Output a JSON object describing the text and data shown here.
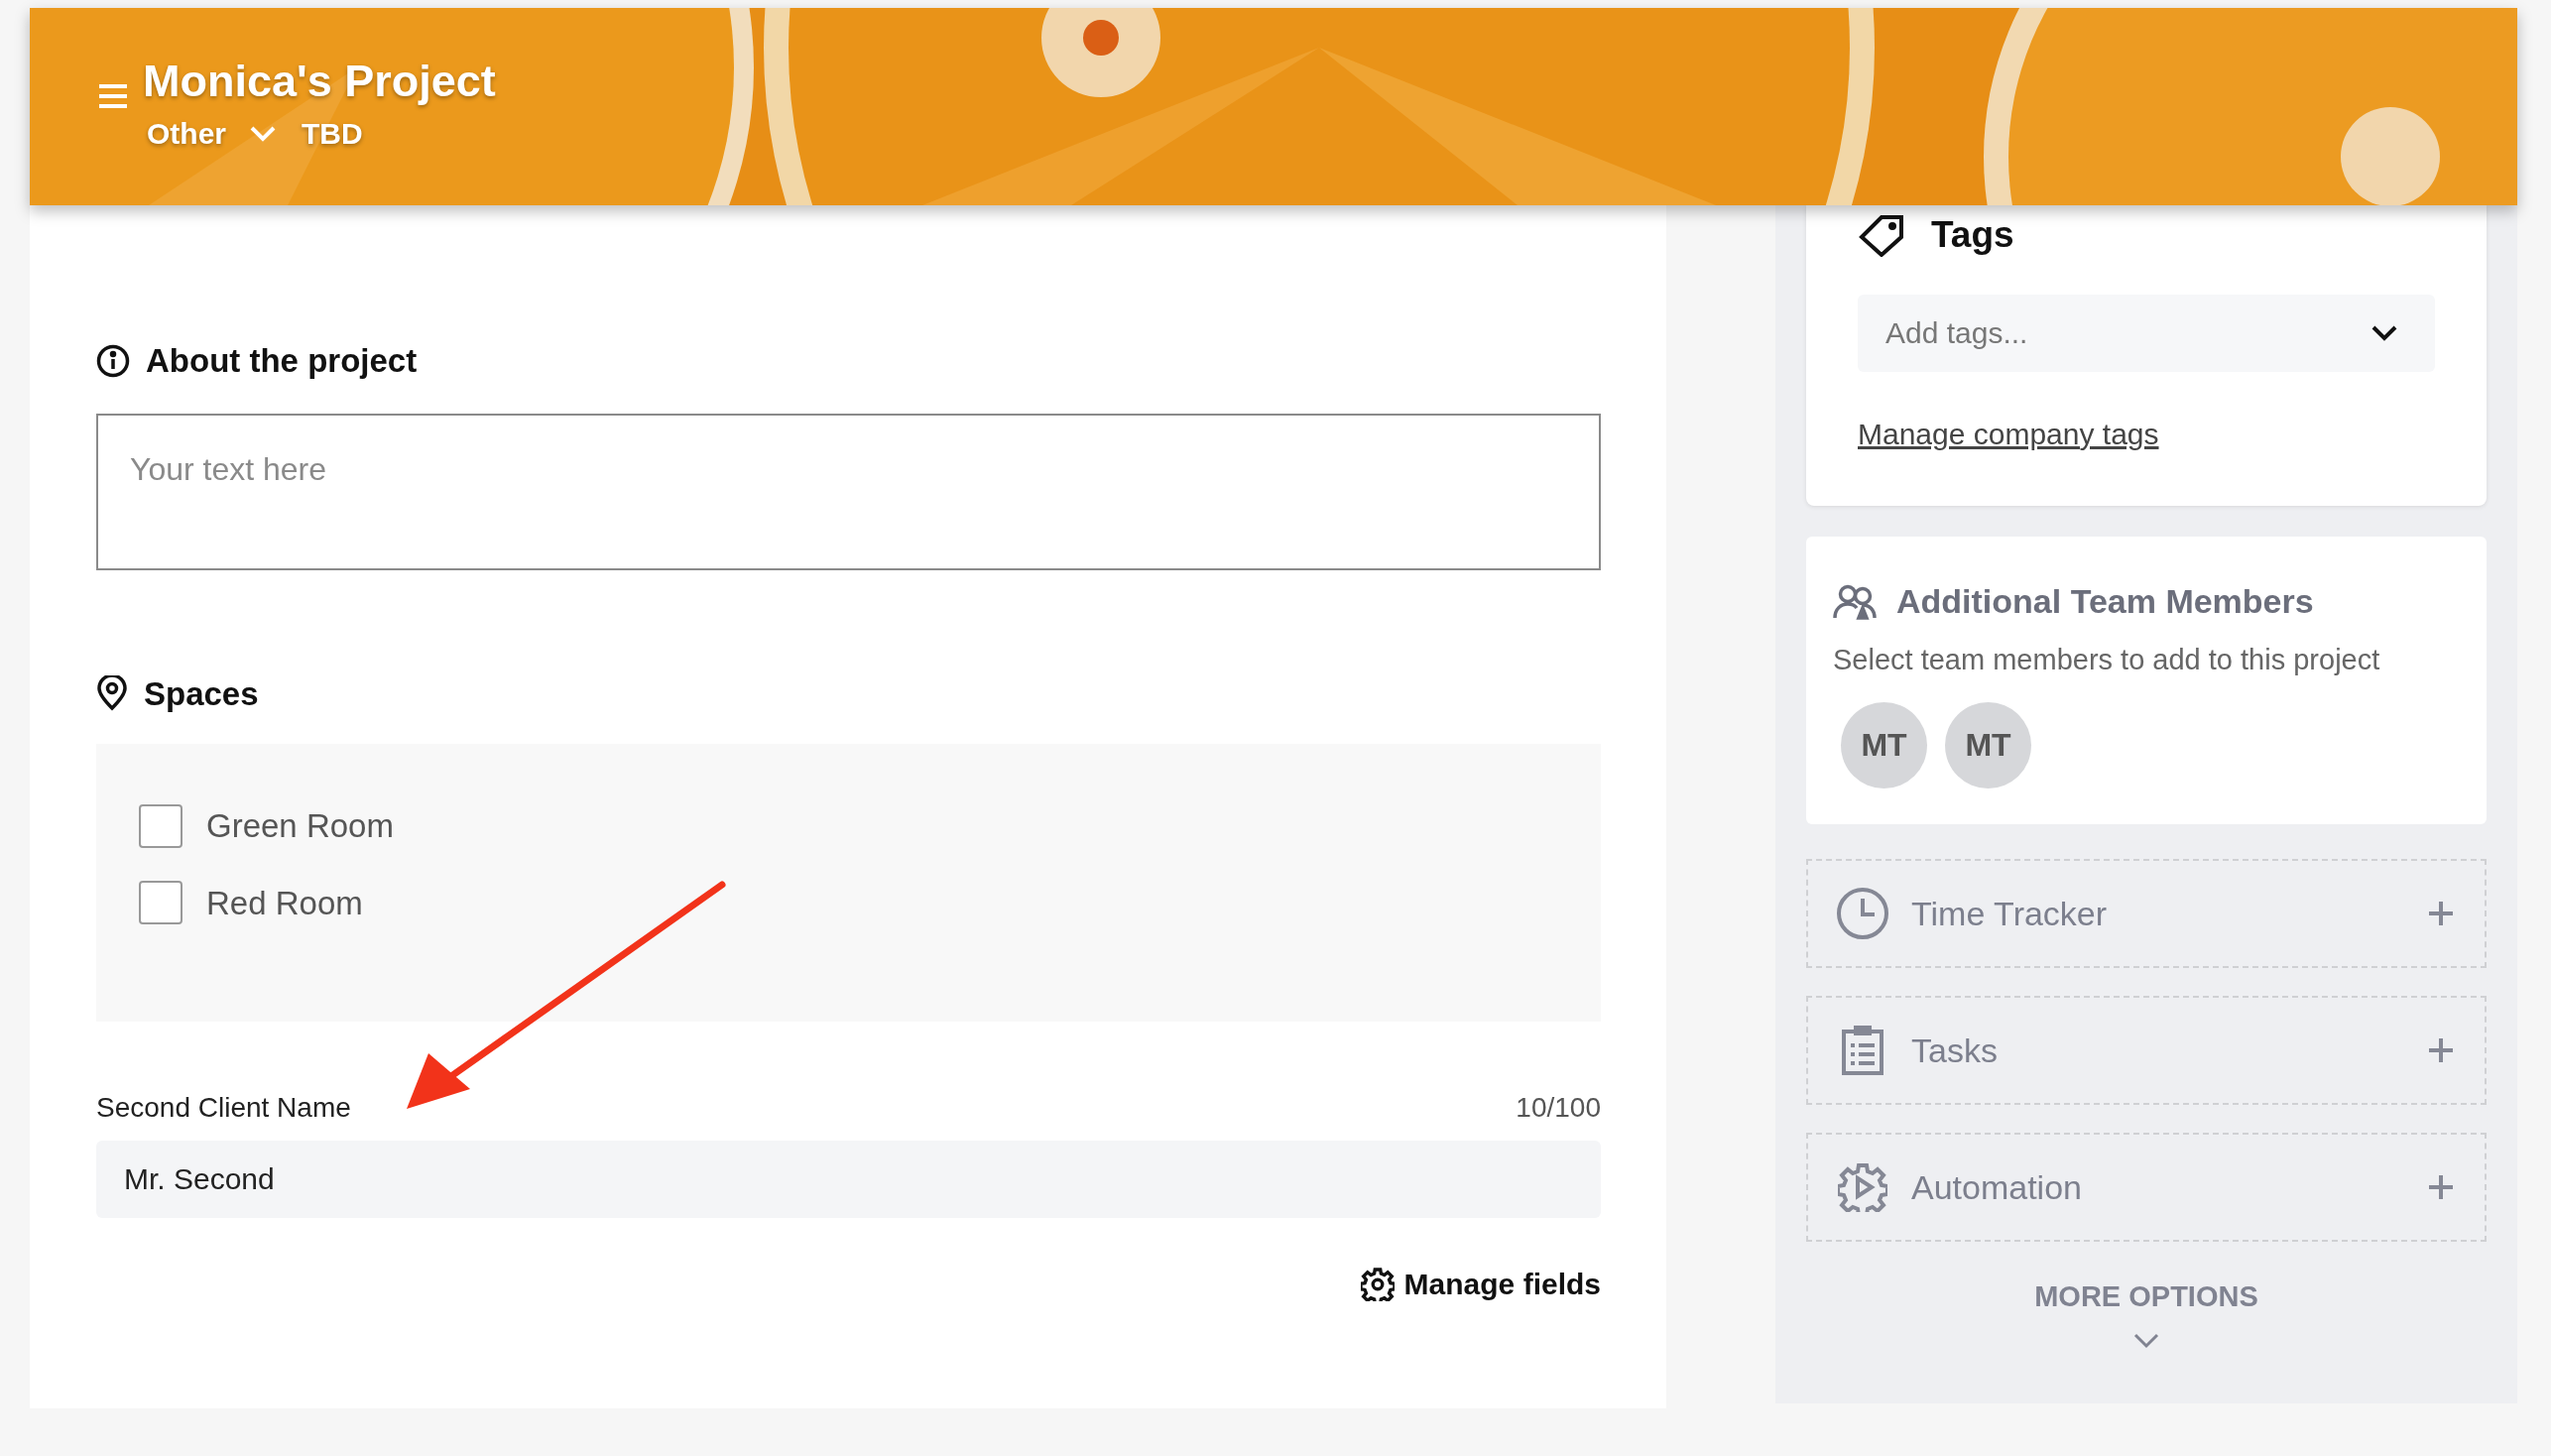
{
  "header": {
    "title": "Monica's Project",
    "category": "Other",
    "status": "TBD"
  },
  "about": {
    "heading": "About the project",
    "placeholder": "Your text here"
  },
  "spaces": {
    "heading": "Spaces",
    "options": [
      {
        "label": "Green Room",
        "checked": false
      },
      {
        "label": "Red Room",
        "checked": false
      }
    ]
  },
  "custom_field": {
    "label": "Second Client Name",
    "counter": "10/100",
    "value": "Mr. Second"
  },
  "manage_fields": "Manage fields",
  "tags": {
    "heading": "Tags",
    "placeholder": "Add tags...",
    "link": "Manage company tags"
  },
  "team": {
    "heading": "Additional Team Members",
    "subtitle": "Select team members to add to this project",
    "members": [
      "MT",
      "MT"
    ]
  },
  "modules": [
    {
      "kind": "clock",
      "label": "Time Tracker"
    },
    {
      "kind": "clipboard",
      "label": "Tasks"
    },
    {
      "kind": "automation",
      "label": "Automation"
    }
  ],
  "more_options": "MORE OPTIONS"
}
